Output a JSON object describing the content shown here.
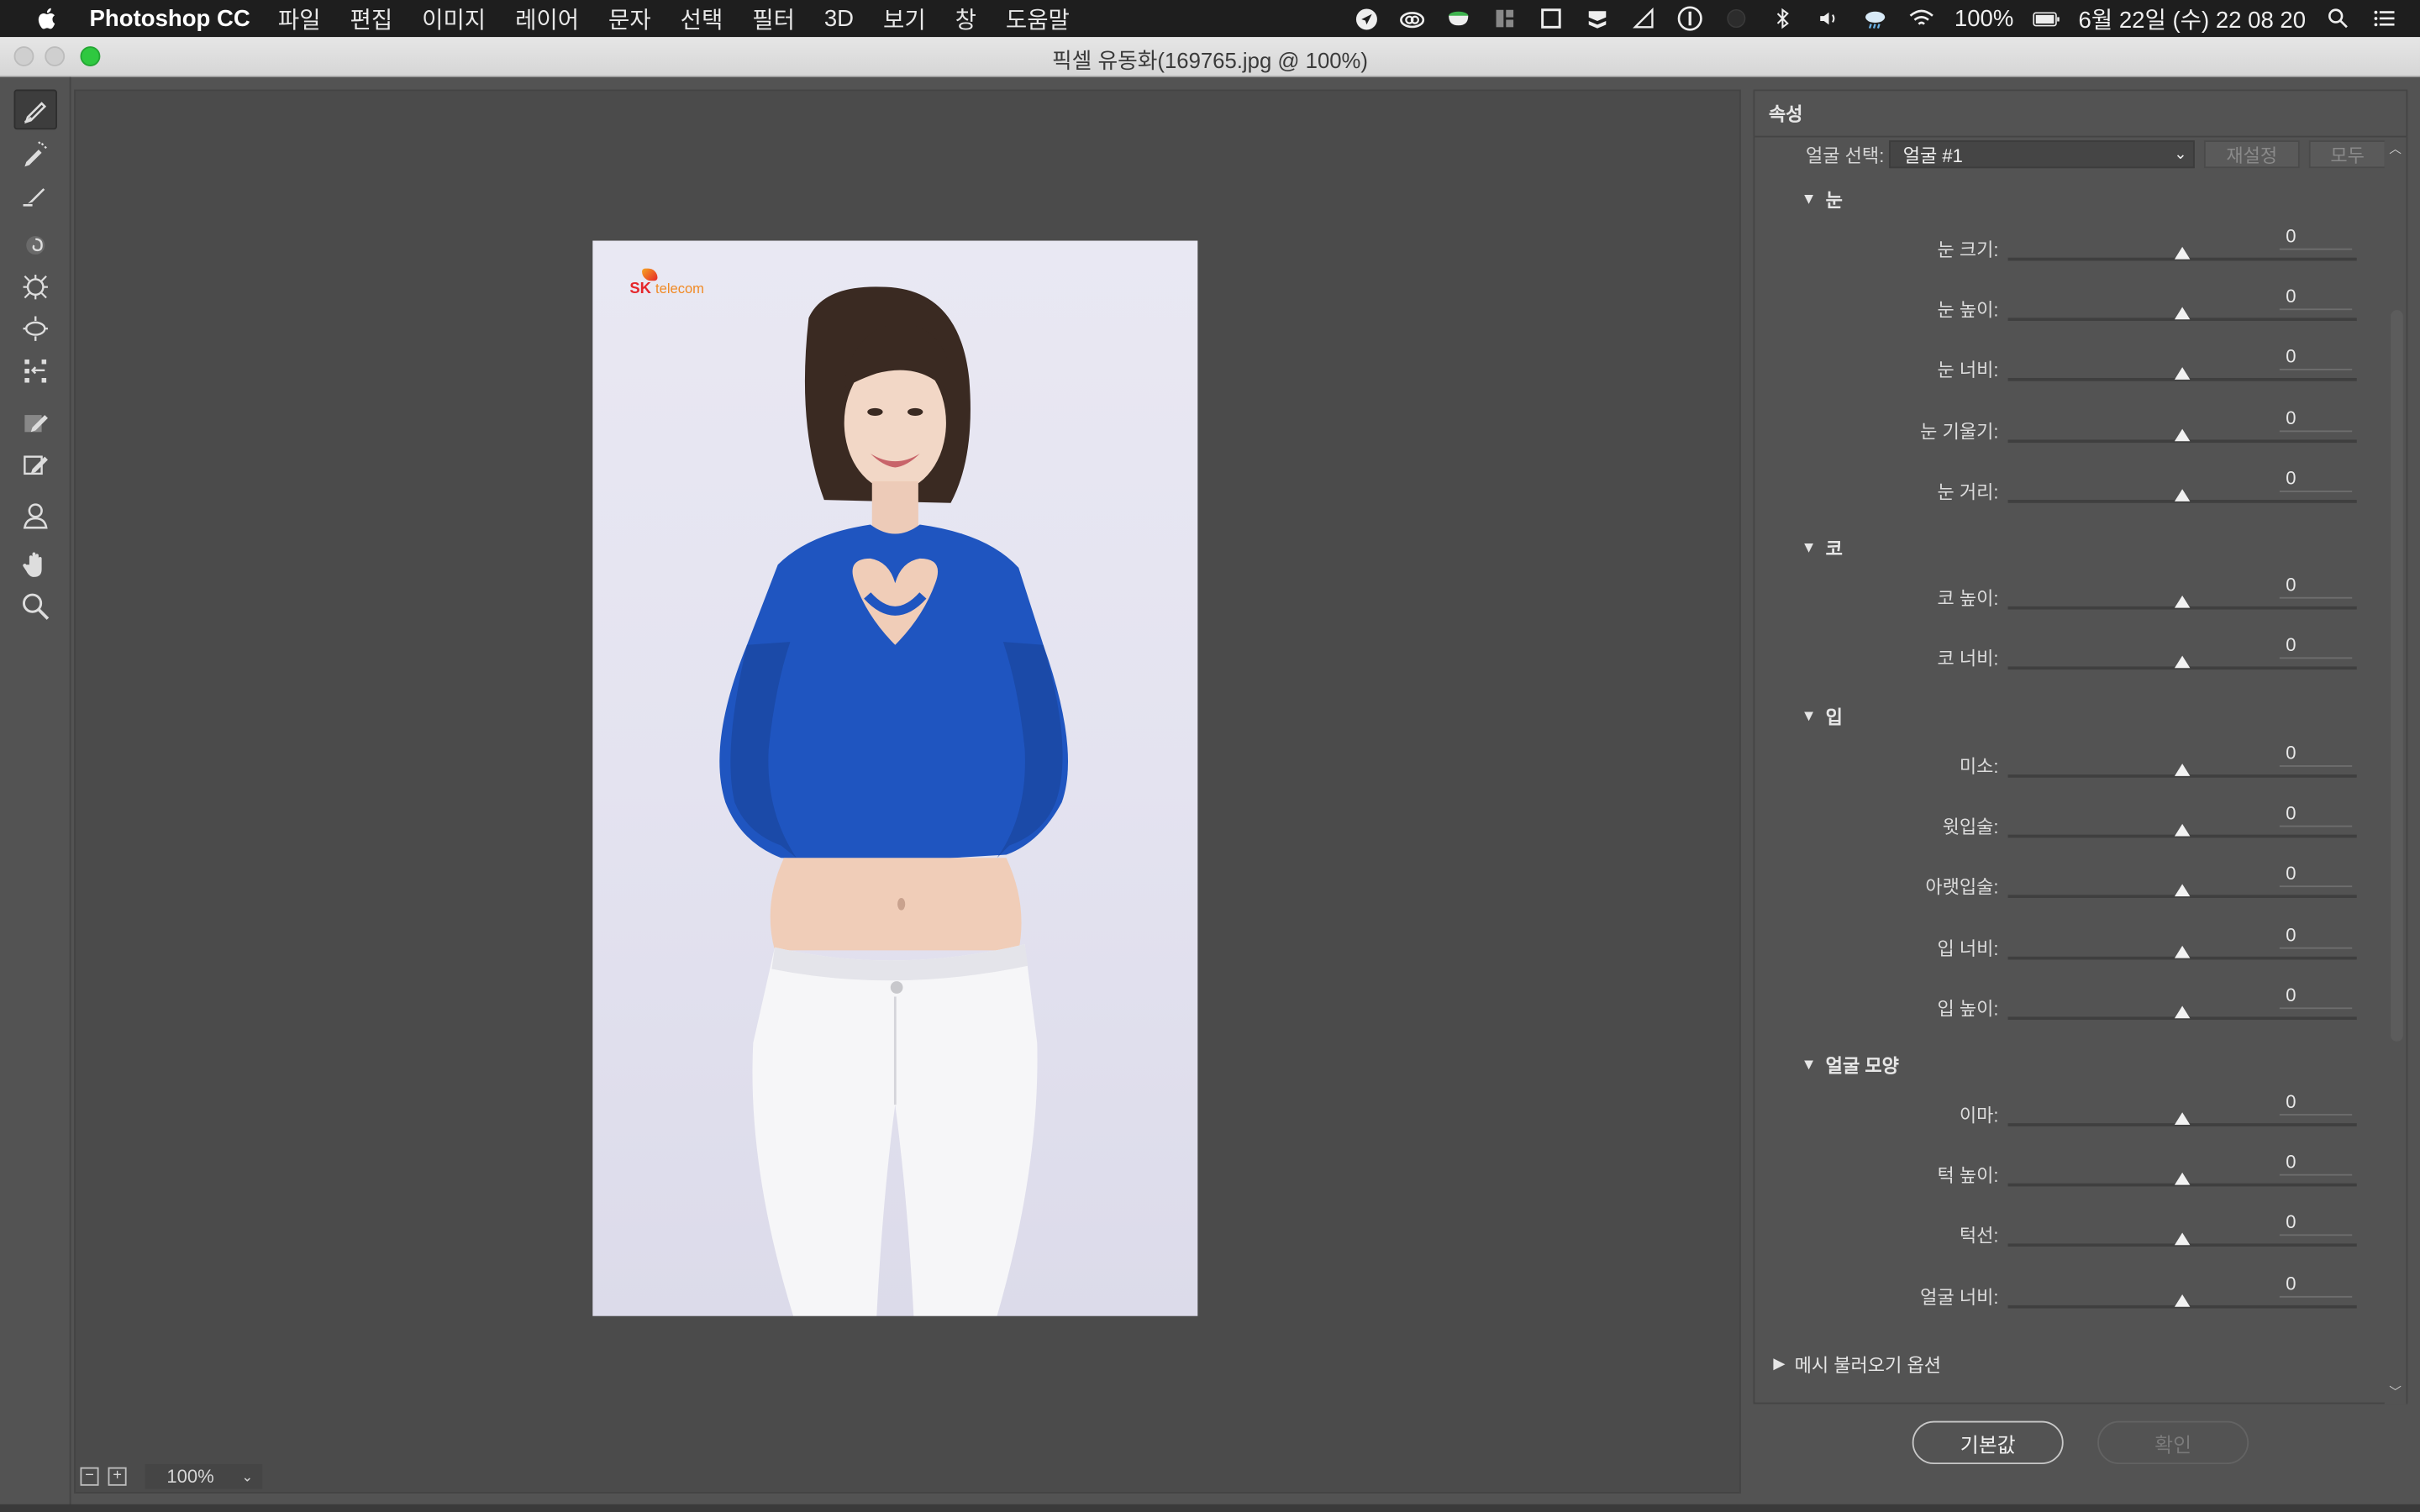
{
  "menubar": {
    "app_name": "Photoshop CC",
    "items": [
      "파일",
      "편집",
      "이미지",
      "레이어",
      "문자",
      "선택",
      "필터",
      "3D",
      "보기",
      "창",
      "도움말"
    ],
    "battery": "100%",
    "clock": "6월 22일 (수)  22 08 20"
  },
  "window": {
    "title": "픽셀 유동화(169765.jpg @ 100%)"
  },
  "canvas": {
    "logo_sk": "SK",
    "logo_telecom": "telecom"
  },
  "zoom": {
    "minus": "−",
    "plus": "+",
    "level": "100%"
  },
  "panel": {
    "title": "속성",
    "face_select_label": "얼굴 선택:",
    "face_select_value": "얼굴 #1",
    "reset_label": "재설정",
    "all_label": "모두",
    "sections": [
      {
        "name": "눈",
        "sliders": [
          {
            "label": "눈 크기:",
            "value": "0"
          },
          {
            "label": "눈 높이:",
            "value": "0"
          },
          {
            "label": "눈 너비:",
            "value": "0"
          },
          {
            "label": "눈 기울기:",
            "value": "0"
          },
          {
            "label": "눈 거리:",
            "value": "0"
          }
        ]
      },
      {
        "name": "코",
        "sliders": [
          {
            "label": "코 높이:",
            "value": "0"
          },
          {
            "label": "코 너비:",
            "value": "0"
          }
        ]
      },
      {
        "name": "입",
        "sliders": [
          {
            "label": "미소:",
            "value": "0"
          },
          {
            "label": "윗입술:",
            "value": "0"
          },
          {
            "label": "아랫입술:",
            "value": "0"
          },
          {
            "label": "입 너비:",
            "value": "0"
          },
          {
            "label": "입 높이:",
            "value": "0"
          }
        ]
      },
      {
        "name": "얼굴 모양",
        "sliders": [
          {
            "label": "이마:",
            "value": "0"
          },
          {
            "label": "턱 높이:",
            "value": "0"
          },
          {
            "label": "턱선:",
            "value": "0"
          },
          {
            "label": "얼굴 너비:",
            "value": "0"
          }
        ]
      }
    ],
    "mesh_label": "메시 불러오기 옵션"
  },
  "buttons": {
    "default_label": "기본값",
    "ok_label": "확인"
  },
  "colors": {
    "workspace": "#535353",
    "sweater": "#1f55c0",
    "menubar": "#1e1e1e"
  }
}
